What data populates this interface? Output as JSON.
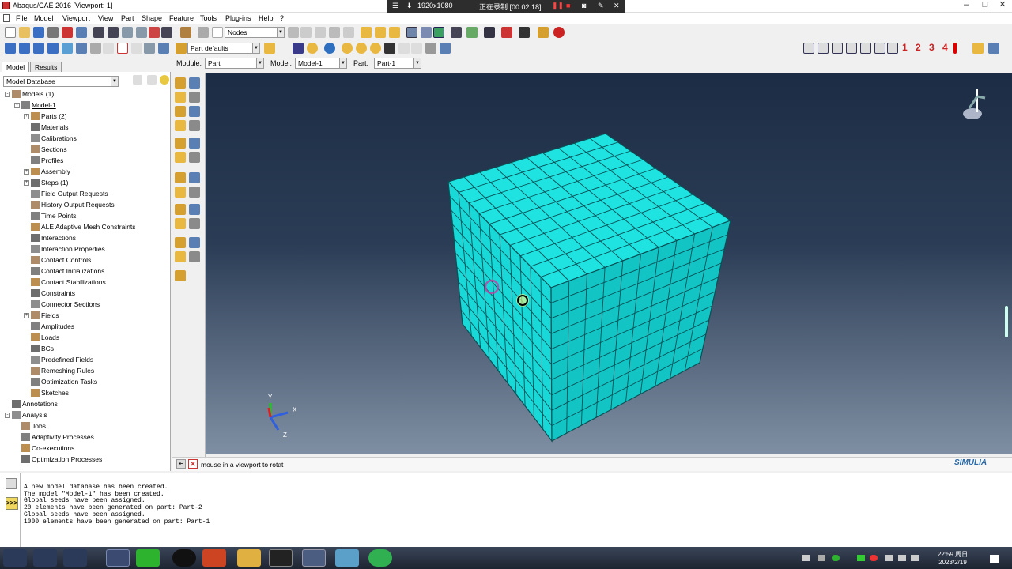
{
  "window": {
    "title": "Abaqus/CAE 2016 [Viewport: 1]"
  },
  "recorder": {
    "resolution": "1920x1080",
    "status": "正在录制 [00:02:18]"
  },
  "menubar": {
    "items": [
      "File",
      "Model",
      "Viewport",
      "View",
      "Part",
      "Shape",
      "Feature",
      "Tools",
      "Plug-ins",
      "Help",
      "?"
    ]
  },
  "toolbar": {
    "selection_filter": "Nodes",
    "render_style": "Part defaults"
  },
  "context": {
    "module_label": "Module:",
    "module_value": "Part",
    "model_label": "Model:",
    "model_value": "Model-1",
    "part_label": "Part:",
    "part_value": "Part-1"
  },
  "view_shortcuts": [
    "1",
    "2",
    "3",
    "4"
  ],
  "tabs": [
    "Model",
    "Results"
  ],
  "tree": {
    "db_selector": "Model Database",
    "items": [
      {
        "label": "Models (1)",
        "level": 0,
        "pm": "-"
      },
      {
        "label": "Model-1",
        "level": 1,
        "pm": "-",
        "underline": true
      },
      {
        "label": "Parts (2)",
        "level": 2,
        "pm": "+"
      },
      {
        "label": "Materials",
        "level": 2
      },
      {
        "label": "Calibrations",
        "level": 2
      },
      {
        "label": "Sections",
        "level": 2
      },
      {
        "label": "Profiles",
        "level": 2
      },
      {
        "label": "Assembly",
        "level": 2,
        "pm": "+"
      },
      {
        "label": "Steps (1)",
        "level": 2,
        "pm": "+"
      },
      {
        "label": "Field Output Requests",
        "level": 2
      },
      {
        "label": "History Output Requests",
        "level": 2
      },
      {
        "label": "Time Points",
        "level": 2
      },
      {
        "label": "ALE Adaptive Mesh Constraints",
        "level": 2
      },
      {
        "label": "Interactions",
        "level": 2
      },
      {
        "label": "Interaction Properties",
        "level": 2
      },
      {
        "label": "Contact Controls",
        "level": 2
      },
      {
        "label": "Contact Initializations",
        "level": 2
      },
      {
        "label": "Contact Stabilizations",
        "level": 2
      },
      {
        "label": "Constraints",
        "level": 2
      },
      {
        "label": "Connector Sections",
        "level": 2
      },
      {
        "label": "Fields",
        "level": 2,
        "pm": "+"
      },
      {
        "label": "Amplitudes",
        "level": 2
      },
      {
        "label": "Loads",
        "level": 2
      },
      {
        "label": "BCs",
        "level": 2
      },
      {
        "label": "Predefined Fields",
        "level": 2
      },
      {
        "label": "Remeshing Rules",
        "level": 2
      },
      {
        "label": "Optimization Tasks",
        "level": 2
      },
      {
        "label": "Sketches",
        "level": 2
      },
      {
        "label": "Annotations",
        "level": 0
      },
      {
        "label": "Analysis",
        "level": 0,
        "pm": "-"
      },
      {
        "label": "Jobs",
        "level": 1
      },
      {
        "label": "Adaptivity Processes",
        "level": 1
      },
      {
        "label": "Co-executions",
        "level": 1
      },
      {
        "label": "Optimization Processes",
        "level": 1
      }
    ]
  },
  "triad": {
    "x": "X",
    "y": "Y",
    "z": "Z"
  },
  "prompt": {
    "text": "mouse in a viewport to rotat"
  },
  "brand": {
    "name": "SIMULIA"
  },
  "messages": [
    "A new model database has been created.",
    "The model \"Model-1\" has been created.",
    "Global seeds have been assigned.",
    "20 elements have been generated on part: Part-2",
    "Global seeds have been assigned.",
    "1000 elements have been generated on part: Part-1"
  ],
  "clock": {
    "time": "22:59 周日",
    "date": "2023/2/19"
  },
  "colors": {
    "mesh": "#19d8d8",
    "mesh_right": "#12c4c4",
    "mesh_top": "#1ee3e1",
    "accent_red": "#cc2222"
  }
}
